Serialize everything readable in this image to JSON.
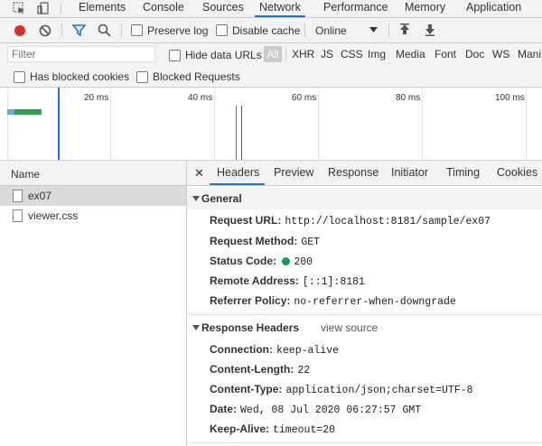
{
  "tabs": [
    "Elements",
    "Console",
    "Sources",
    "Network",
    "Performance",
    "Memory",
    "Application"
  ],
  "active_tab": "Network",
  "toolbar": {
    "preserve_log": "Preserve log",
    "disable_cache": "Disable cache",
    "throttling": "Online"
  },
  "filter": {
    "placeholder": "Filter",
    "hide_data_urls": "Hide data URLs",
    "all": "All",
    "types": [
      "XHR",
      "JS",
      "CSS",
      "Img",
      "Media",
      "Font",
      "Doc",
      "WS",
      "Mani"
    ]
  },
  "blocked": {
    "has_blocked_cookies": "Has blocked cookies",
    "blocked_requests": "Blocked Requests"
  },
  "timeline": {
    "ticks": [
      "20 ms",
      "40 ms",
      "60 ms",
      "80 ms",
      "100 ms"
    ]
  },
  "requests": {
    "header": "Name",
    "items": [
      "ex07",
      "viewer.css"
    ]
  },
  "detail_tabs": [
    "Headers",
    "Preview",
    "Response",
    "Initiator",
    "Timing",
    "Cookies"
  ],
  "general": {
    "title": "General",
    "request_url_key": "Request URL:",
    "request_url": "http://localhost:8181/sample/ex07",
    "request_method_key": "Request Method:",
    "request_method": "GET",
    "status_code_key": "Status Code:",
    "status_code": "200",
    "remote_address_key": "Remote Address:",
    "remote_address": "[::1]:8181",
    "referrer_policy_key": "Referrer Policy:",
    "referrer_policy": "no-referrer-when-downgrade"
  },
  "response_headers": {
    "title": "Response Headers",
    "view_source": "view source",
    "connection_key": "Connection:",
    "connection": "keep-alive",
    "content_length_key": "Content-Length:",
    "content_length": "22",
    "content_type_key": "Content-Type:",
    "content_type": "application/json;charset=UTF-8",
    "date_key": "Date:",
    "date": "Wed, 08 Jul 2020 06:27:57 GMT",
    "keep_alive_key": "Keep-Alive:",
    "keep_alive": "timeout=20"
  },
  "colors": {
    "accent": "#1a73e8",
    "record": "#d93025",
    "status_ok": "#0f9d58"
  }
}
